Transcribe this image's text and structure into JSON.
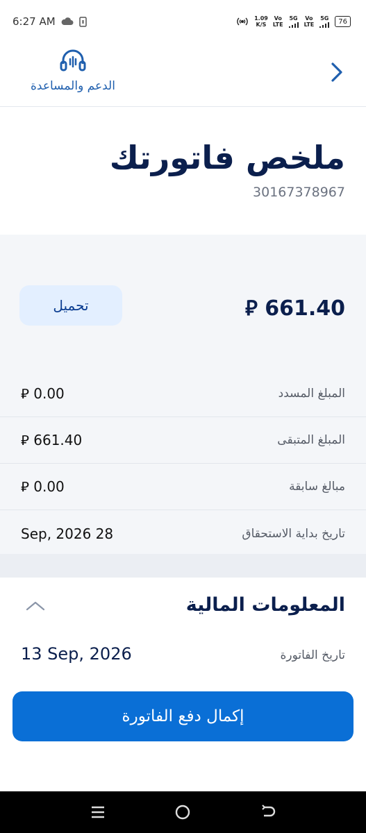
{
  "status_bar": {
    "time": "6:27 AM",
    "speed_value": "1.09",
    "speed_unit": "K/S",
    "net1_top": "Vo",
    "net1_bottom": "LTE",
    "net2": "5G",
    "net3_top": "Vo",
    "net3_bottom": "LTE",
    "net4": "5G",
    "battery": "76"
  },
  "header": {
    "support_label": "الدعم والمساعدة"
  },
  "page": {
    "title": "ملخص فاتورتك",
    "account_number": "30167378967"
  },
  "summary": {
    "total_amount": "661.40 ⃁",
    "download_label": "تحميل",
    "rows": [
      {
        "label": "المبلغ المسدد",
        "value": "0.00 ⃁"
      },
      {
        "label": "المبلغ المتبقى",
        "value": "661.40 ⃁"
      },
      {
        "label": "مبالغ سابقة",
        "value": "0.00 ⃁"
      },
      {
        "label": "تاريخ بداية الاستحقاق",
        "value": "28 Sep, 2026"
      }
    ]
  },
  "financial_info": {
    "title": "المعلومات المالية",
    "invoice_date_label": "تاريخ الفاتورة",
    "invoice_date_value": "13 Sep, 2026"
  },
  "actions": {
    "pay_label": "إكمال دفع الفاتورة"
  },
  "colors": {
    "primary": "#0a6fd6",
    "navy": "#0b1f4d",
    "panel": "#f4f6f9"
  }
}
